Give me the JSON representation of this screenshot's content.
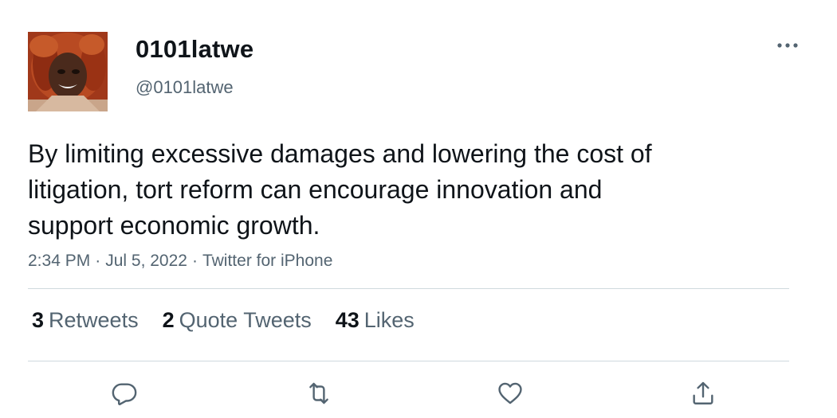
{
  "user": {
    "display_name": "0101latwe",
    "handle": "@0101latwe"
  },
  "tweet": {
    "text": "By limiting excessive damages and lowering the cost of\nlitigation, tort reform can encourage innovation and\nsupport economic growth.",
    "time": "2:34 PM",
    "date": "Jul 5, 2022",
    "source": "Twitter for iPhone",
    "separator": "·"
  },
  "stats": {
    "retweets": {
      "count": "3",
      "label": "Retweets"
    },
    "quote_tweets": {
      "count": "2",
      "label": "Quote Tweets"
    },
    "likes": {
      "count": "43",
      "label": "Likes"
    }
  },
  "icons": {
    "more": "more-horizontal-icon",
    "reply": "reply-icon",
    "retweet": "retweet-icon",
    "like": "heart-icon",
    "share": "share-icon"
  },
  "colors": {
    "text_primary": "#0f1419",
    "text_secondary": "#536471",
    "divider": "#cfd9de"
  }
}
